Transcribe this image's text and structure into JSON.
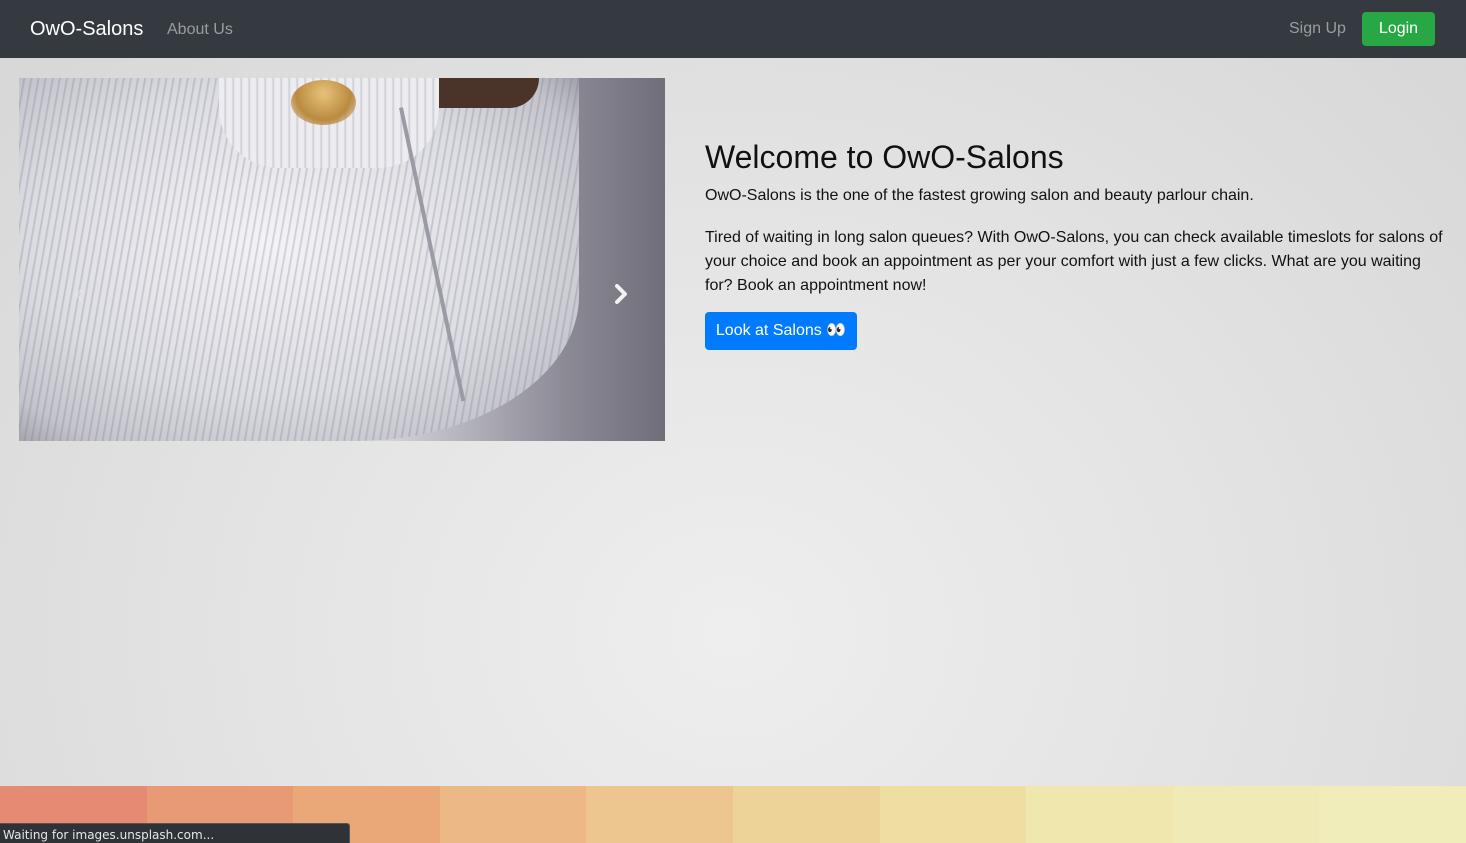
{
  "navbar": {
    "brand": "OwO-Salons",
    "links": [
      {
        "label": "About Us"
      }
    ],
    "signup_label": "Sign Up",
    "login_label": "Login"
  },
  "carousel": {
    "prev_icon": "chevron-left-icon",
    "next_icon": "chevron-right-icon"
  },
  "hero": {
    "title": "Welcome to OwO-Salons",
    "lead": "OwO-Salons is the one of the fastest growing salon and beauty parlour chain.",
    "body": "Tired of waiting in long salon queues? With OwO-Salons, you can check available timeslots for salons of your choice and book an appointment as per your comfort with just a few clicks. What are you waiting for? Book an appointment now!",
    "cta_label": "Look at Salons 👀"
  },
  "footer": {
    "colors": [
      "#e68a74",
      "#e89a74",
      "#eaa878",
      "#ecb885",
      "#edc58f",
      "#eed398",
      "#eedea2",
      "#efe7ad",
      "#f0ebb6",
      "#f1edbb"
    ]
  },
  "status": {
    "text": "Waiting for images.unsplash.com..."
  },
  "colors": {
    "navbar_bg": "#343a40",
    "login_button": "#28a745",
    "cta_button": "#007bff"
  }
}
